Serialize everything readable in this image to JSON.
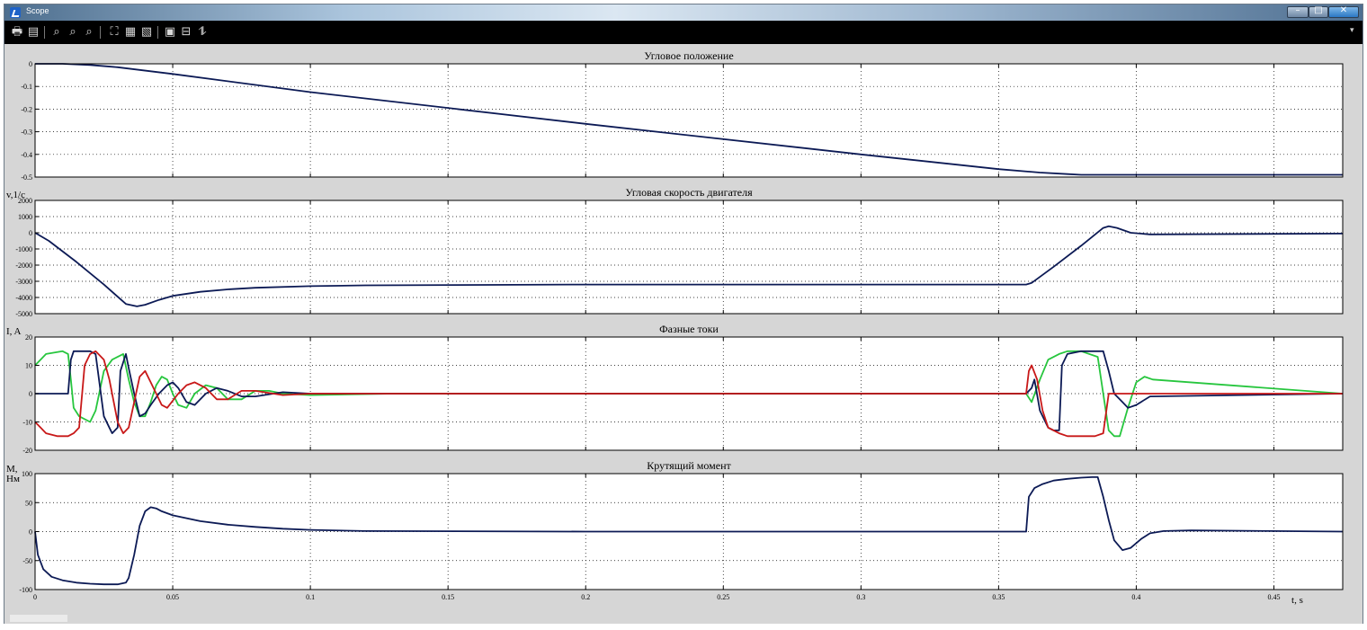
{
  "window": {
    "title": "Scope",
    "controls": {
      "minimize": "–",
      "maximize": "□",
      "close": "✕"
    }
  },
  "toolbar": {
    "buttons": [
      {
        "name": "print-icon",
        "glyph": "🖶"
      },
      {
        "name": "parameters-icon",
        "glyph": "▤"
      },
      {
        "name": "zoom-in-icon",
        "glyph": "⌕"
      },
      {
        "name": "zoom-x-icon",
        "glyph": "⌕"
      },
      {
        "name": "zoom-y-icon",
        "glyph": "⌕"
      },
      {
        "name": "autoscale-icon",
        "glyph": "⛶"
      },
      {
        "name": "save-axes-icon",
        "glyph": "▦"
      },
      {
        "name": "restore-axes-icon",
        "glyph": "▧"
      },
      {
        "name": "floating-scope-icon",
        "glyph": "▣"
      },
      {
        "name": "lock-axes-icon",
        "glyph": "⊟"
      },
      {
        "name": "signal-selection-icon",
        "glyph": "⥮"
      }
    ]
  },
  "colors": {
    "dark_blue": "#0c1a55",
    "red": "#c81818",
    "green": "#27c63e"
  },
  "chart_data": [
    {
      "type": "line",
      "title": "Угловое положение",
      "ylabel": "",
      "ylim": [
        -0.5,
        0
      ],
      "yticks": [
        0,
        -0.1,
        -0.2,
        -0.3,
        -0.4,
        -0.5
      ],
      "ytick_labels": [
        "0",
        "-0.1",
        "-0.2",
        "-0.3",
        "-0.4",
        "-0.5"
      ],
      "xlim": [
        0,
        0.475
      ],
      "grid": true,
      "series": [
        {
          "color": "#0c1a55",
          "x": [
            0,
            0.01,
            0.02,
            0.03,
            0.05,
            0.1,
            0.2,
            0.3,
            0.35,
            0.365,
            0.375,
            0.38,
            0.39,
            0.475
          ],
          "y": [
            0,
            0,
            -0.005,
            -0.015,
            -0.045,
            -0.125,
            -0.265,
            -0.4,
            -0.465,
            -0.48,
            -0.487,
            -0.49,
            -0.49,
            -0.49
          ]
        }
      ]
    },
    {
      "type": "line",
      "title": "Угловая скорость двигателя",
      "ylabel": "v,1/c",
      "ylim": [
        -5000,
        2000
      ],
      "yticks": [
        2000,
        1000,
        0,
        -1000,
        -2000,
        -3000,
        -4000,
        -5000
      ],
      "ytick_labels": [
        "2000",
        "1000",
        "0",
        "-1000",
        "-2000",
        "-3000",
        "-4000",
        "-5000"
      ],
      "xlim": [
        0,
        0.475
      ],
      "grid": true,
      "series": [
        {
          "color": "#0c1a55",
          "x": [
            0,
            0.005,
            0.015,
            0.025,
            0.033,
            0.037,
            0.04,
            0.045,
            0.05,
            0.06,
            0.07,
            0.08,
            0.1,
            0.12,
            0.2,
            0.3,
            0.36,
            0.362,
            0.37,
            0.38,
            0.388,
            0.39,
            0.393,
            0.398,
            0.405,
            0.475
          ],
          "y": [
            0,
            -500,
            -1800,
            -3200,
            -4400,
            -4550,
            -4450,
            -4150,
            -3900,
            -3650,
            -3500,
            -3400,
            -3300,
            -3250,
            -3200,
            -3200,
            -3200,
            -3100,
            -2100,
            -800,
            300,
            400,
            300,
            0,
            -100,
            -50
          ]
        }
      ]
    },
    {
      "type": "line",
      "title": "Фазные токи",
      "ylabel": "I, A",
      "ylim": [
        -20,
        20
      ],
      "yticks": [
        20,
        10,
        0,
        -10,
        -20
      ],
      "ytick_labels": [
        "20",
        "10",
        "0",
        "-10",
        "-20"
      ],
      "xlim": [
        0,
        0.475
      ],
      "grid": true,
      "series": [
        {
          "color": "#27c63e",
          "x": [
            0,
            0.002,
            0.004,
            0.01,
            0.012,
            0.013,
            0.014,
            0.016,
            0.02,
            0.022,
            0.025,
            0.028,
            0.03,
            0.032,
            0.034,
            0.036,
            0.038,
            0.04,
            0.042,
            0.044,
            0.046,
            0.048,
            0.05,
            0.052,
            0.055,
            0.058,
            0.062,
            0.066,
            0.07,
            0.075,
            0.08,
            0.085,
            0.09,
            0.1,
            0.13,
            0.36,
            0.362,
            0.365,
            0.368,
            0.372,
            0.375,
            0.38,
            0.386,
            0.388,
            0.39,
            0.392,
            0.394,
            0.397,
            0.4,
            0.403,
            0.406,
            0.475
          ],
          "y": [
            10,
            12,
            14,
            15,
            14,
            5,
            -5,
            -8,
            -10,
            -6,
            8,
            12,
            13,
            14,
            5,
            -3,
            -8,
            -8,
            -3,
            3,
            6,
            5,
            0,
            -4,
            -5,
            0,
            3,
            2,
            -2,
            -2,
            1,
            1,
            0,
            -0.5,
            0,
            0,
            -3,
            5,
            12,
            14,
            15,
            15,
            13,
            0,
            -13,
            -15,
            -15,
            -5,
            4,
            6,
            5,
            0
          ]
        },
        {
          "color": "#0c1a55",
          "x": [
            0,
            0.012,
            0.013,
            0.014,
            0.016,
            0.02,
            0.022,
            0.025,
            0.027,
            0.028,
            0.03,
            0.031,
            0.033,
            0.034,
            0.036,
            0.038,
            0.04,
            0.042,
            0.045,
            0.048,
            0.05,
            0.052,
            0.055,
            0.058,
            0.062,
            0.066,
            0.07,
            0.075,
            0.08,
            0.09,
            0.1,
            0.13,
            0.36,
            0.362,
            0.363,
            0.365,
            0.368,
            0.37,
            0.372,
            0.373,
            0.375,
            0.38,
            0.385,
            0.388,
            0.39,
            0.392,
            0.395,
            0.397,
            0.4,
            0.405,
            0.475
          ],
          "y": [
            0,
            0,
            12,
            15,
            15,
            15,
            14,
            -8,
            -12,
            -14,
            -12,
            8,
            14,
            9,
            0,
            -8,
            -7,
            -4,
            0,
            3,
            4,
            2,
            -3,
            -4,
            0,
            2,
            1,
            -1,
            -1,
            0.5,
            0,
            0,
            0,
            2,
            5,
            -6,
            -12,
            -13,
            -13,
            10,
            14,
            15,
            15,
            15,
            8,
            0,
            -3,
            -5,
            -4,
            -1,
            0
          ]
        },
        {
          "color": "#c81818",
          "x": [
            0,
            0.002,
            0.004,
            0.008,
            0.012,
            0.014,
            0.016,
            0.018,
            0.02,
            0.022,
            0.025,
            0.027,
            0.03,
            0.032,
            0.034,
            0.036,
            0.038,
            0.04,
            0.042,
            0.044,
            0.046,
            0.048,
            0.052,
            0.055,
            0.058,
            0.062,
            0.066,
            0.07,
            0.075,
            0.08,
            0.09,
            0.1,
            0.13,
            0.36,
            0.361,
            0.362,
            0.364,
            0.366,
            0.368,
            0.372,
            0.375,
            0.38,
            0.385,
            0.388,
            0.39,
            0.392,
            0.394,
            0.398,
            0.475
          ],
          "y": [
            -10,
            -12,
            -14,
            -15,
            -15,
            -14,
            -12,
            10,
            14,
            15,
            12,
            5,
            -10,
            -14,
            -12,
            -3,
            6,
            8,
            4,
            0,
            -4,
            -5,
            0,
            3,
            4,
            2,
            -2,
            -2,
            1,
            1,
            -0.5,
            0,
            0,
            0,
            8,
            10,
            5,
            -6,
            -12,
            -14,
            -15,
            -15,
            -15,
            -14,
            0,
            0,
            0,
            0,
            0
          ]
        }
      ]
    },
    {
      "type": "line",
      "title": "Крутящий момент",
      "ylabel": "M, Нм",
      "ylim": [
        -100,
        100
      ],
      "yticks": [
        100,
        50,
        0,
        -50,
        -100
      ],
      "ytick_labels": [
        "100",
        "50",
        "0",
        "-50",
        "-100"
      ],
      "xlim": [
        0,
        0.475
      ],
      "xticks": [
        0,
        0.05,
        0.1,
        0.15,
        0.2,
        0.25,
        0.3,
        0.35,
        0.4,
        0.45
      ],
      "xtick_labels": [
        "0",
        "0.05",
        "0.1",
        "0.15",
        "0.2",
        "0.25",
        "0.3",
        "0.35",
        "0.4",
        "0.45"
      ],
      "xlabel": "t, s",
      "grid": true,
      "series": [
        {
          "color": "#0c1a55",
          "x": [
            0,
            0.001,
            0.003,
            0.006,
            0.01,
            0.015,
            0.02,
            0.025,
            0.03,
            0.033,
            0.034,
            0.036,
            0.038,
            0.04,
            0.042,
            0.044,
            0.046,
            0.05,
            0.06,
            0.07,
            0.08,
            0.09,
            0.1,
            0.12,
            0.2,
            0.3,
            0.36,
            0.361,
            0.363,
            0.366,
            0.37,
            0.375,
            0.38,
            0.384,
            0.386,
            0.388,
            0.39,
            0.392,
            0.395,
            0.398,
            0.402,
            0.405,
            0.41,
            0.42,
            0.475
          ],
          "y": [
            0,
            -40,
            -65,
            -78,
            -84,
            -88,
            -90,
            -91,
            -91,
            -88,
            -80,
            -40,
            10,
            35,
            42,
            40,
            35,
            28,
            18,
            12,
            8,
            5,
            3,
            1,
            0,
            0,
            0,
            60,
            75,
            82,
            88,
            91,
            93,
            94,
            94,
            60,
            20,
            -15,
            -32,
            -28,
            -12,
            -3,
            1,
            2,
            0
          ]
        }
      ]
    }
  ]
}
